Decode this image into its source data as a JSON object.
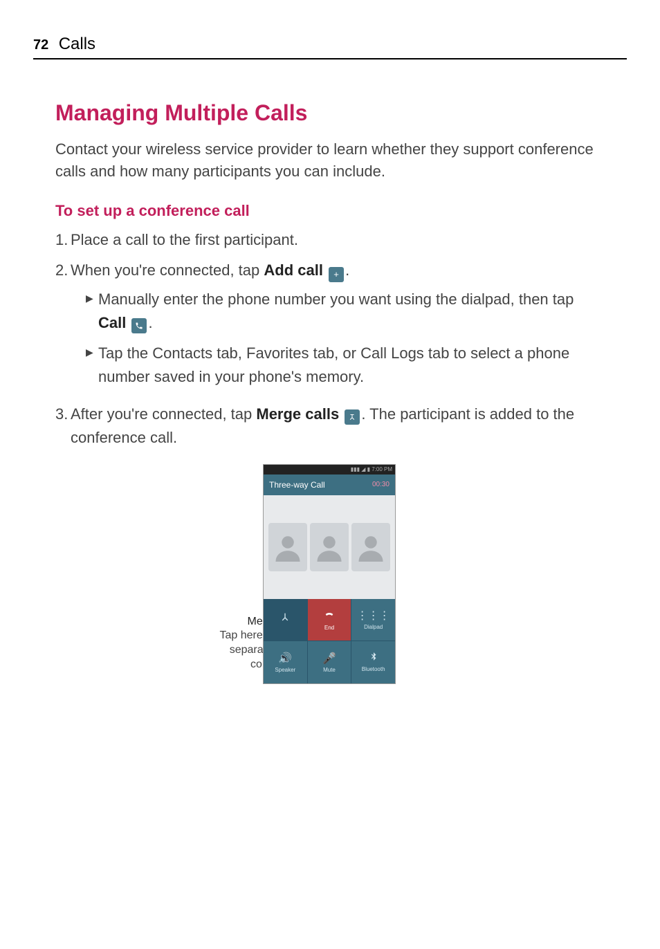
{
  "header": {
    "page_number": "72",
    "section": "Calls"
  },
  "title": "Managing Multiple Calls",
  "intro": "Contact your wireless service provider to learn whether they support conference calls and how many participants you can include.",
  "subheading": "To set up a conference call",
  "steps": {
    "s1": {
      "num": "1.",
      "text": "Place a call to the first participant."
    },
    "s2": {
      "num": "2.",
      "pre": "When you're connected, tap ",
      "strong": "Add call",
      "post": " ",
      "period": ".",
      "bullets": {
        "b1": {
          "pre": "Manually enter the phone number you want using the dialpad, then tap ",
          "strong": "Call",
          "post": " ",
          "period": "."
        },
        "b2": {
          "text": "Tap the Contacts tab, Favorites tab, or Call Logs tab to select a phone number saved in your phone's memory."
        }
      }
    },
    "s3": {
      "num": "3.",
      "pre": "After you're connected, tap ",
      "strong": "Merge calls",
      "post": " ",
      "tail": ". The participant is added to the conference call."
    }
  },
  "callout": {
    "title": "Merge calls Icon",
    "desc": "Tap here to merge the separate calls into a conference call."
  },
  "phone": {
    "status_time": "7:00 PM",
    "header_title": "Three-way Call",
    "timer": "00:30",
    "buttons": {
      "merge": "",
      "end": "End",
      "dialpad": "Dialpad",
      "speaker": "Speaker",
      "mute": "Mute",
      "bluetooth": "Bluetooth"
    }
  }
}
